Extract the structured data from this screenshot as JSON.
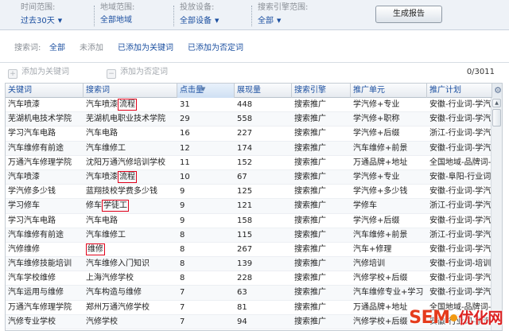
{
  "filters": [
    {
      "label": "时间范围:",
      "value": "过去30天"
    },
    {
      "label": "地域范围:",
      "value": "全部地域"
    },
    {
      "label": "投放设备:",
      "value": "全部设备"
    },
    {
      "label": "搜索引擎范围:",
      "value": "全部"
    }
  ],
  "generate_button": "生成报告",
  "search_word_filter": {
    "label": "搜索词:",
    "all": "全部",
    "not_added": "未添加",
    "added_keyword": "已添加为关键词",
    "added_negative": "已添加为否定词"
  },
  "toolbar": {
    "add_keyword": "添加为关键词",
    "add_negative": "添加为否定词",
    "page_count": "0/3011"
  },
  "table": {
    "columns": [
      "关键词",
      "搜索词",
      "点击量",
      "展现量",
      "搜索引擎",
      "推广单元",
      "推广计划"
    ],
    "sorted_column": 2,
    "rows": [
      {
        "keyword": "汽车喷漆",
        "term_pre": "汽车喷漆",
        "term_hl": "流程",
        "term_post": "",
        "clicks": "31",
        "impressions": "448",
        "engine": "搜索推广",
        "unit": "学汽修+专业",
        "plan": "安徽-行业词-学汽修"
      },
      {
        "keyword": "芜湖机电技术学院",
        "term_pre": "芜湖机电职业技术学院",
        "term_hl": "",
        "term_post": "",
        "clicks": "29",
        "impressions": "558",
        "engine": "搜索推广",
        "unit": "学汽修+职称",
        "plan": "安徽-行业词-学汽修"
      },
      {
        "keyword": "学习汽车电路",
        "term_pre": "汽车电路",
        "term_hl": "",
        "term_post": "",
        "clicks": "16",
        "impressions": "227",
        "engine": "搜索推广",
        "unit": "学汽修+后缀",
        "plan": "浙江-行业词-学汽修"
      },
      {
        "keyword": "汽车维修有前途",
        "term_pre": "汽车维修工",
        "term_hl": "",
        "term_post": "",
        "clicks": "12",
        "impressions": "174",
        "engine": "搜索推广",
        "unit": "汽车维修+前景",
        "plan": "安徽-行业词-学汽修"
      },
      {
        "keyword": "万通汽车修理学院",
        "term_pre": "沈阳万通汽修培训学校",
        "term_hl": "",
        "term_post": "",
        "clicks": "11",
        "impressions": "152",
        "engine": "搜索推广",
        "unit": "万通品牌+地址",
        "plan": "全国地域-品牌词-学"
      },
      {
        "keyword": "汽车喷漆",
        "term_pre": "汽车喷漆",
        "term_hl": "流程",
        "term_post": "",
        "clicks": "10",
        "impressions": "67",
        "engine": "搜索推广",
        "unit": "学汽修+专业",
        "plan": "安徽-阜阳-行业词-学"
      },
      {
        "keyword": "学汽修多少钱",
        "term_pre": "蓝翔技校学费多少钱",
        "term_hl": "",
        "term_post": "",
        "clicks": "9",
        "impressions": "125",
        "engine": "搜索推广",
        "unit": "学汽修+多少钱",
        "plan": "安徽-行业词-学汽修"
      },
      {
        "keyword": "学习修车",
        "term_pre": "修车",
        "term_hl": "学徒工",
        "term_post": "",
        "clicks": "9",
        "impressions": "121",
        "engine": "搜索推广",
        "unit": "学修车",
        "plan": "浙江-行业词-学汽修"
      },
      {
        "keyword": "学习汽车电路",
        "term_pre": "汽车电路",
        "term_hl": "",
        "term_post": "",
        "clicks": "9",
        "impressions": "158",
        "engine": "搜索推广",
        "unit": "学汽修+后缀",
        "plan": "安徽-行业词-学汽修"
      },
      {
        "keyword": "汽车维修有前途",
        "term_pre": "汽车维修工",
        "term_hl": "",
        "term_post": "",
        "clicks": "8",
        "impressions": "115",
        "engine": "搜索推广",
        "unit": "汽车维修+前景",
        "plan": "浙江-行业词-学汽修"
      },
      {
        "keyword": "汽修维修",
        "term_pre": "",
        "term_hl": "维修",
        "term_post": "",
        "clicks": "8",
        "impressions": "267",
        "engine": "搜索推广",
        "unit": "汽车+修理",
        "plan": "安徽-行业词-学汽修"
      },
      {
        "keyword": "汽车维修技能培训",
        "term_pre": "汽车维修入门知识",
        "term_hl": "",
        "term_post": "",
        "clicks": "8",
        "impressions": "139",
        "engine": "搜索推广",
        "unit": "汽修培训",
        "plan": "安徽-行业词-培训"
      },
      {
        "keyword": "汽车学校维修",
        "term_pre": "上海汽修学校",
        "term_hl": "",
        "term_post": "",
        "clicks": "8",
        "impressions": "228",
        "engine": "搜索推广",
        "unit": "汽修学校+后缀",
        "plan": "安徽-行业词-学汽修"
      },
      {
        "keyword": "汽车运用与维修",
        "term_pre": "汽车构造与维修",
        "term_hl": "",
        "term_post": "",
        "clicks": "7",
        "impressions": "63",
        "engine": "搜索推广",
        "unit": "汽车维修专业+学习",
        "plan": "安徽-行业词-学汽修"
      },
      {
        "keyword": "万通汽车修理学院",
        "term_pre": "郑州万通汽修学校",
        "term_hl": "",
        "term_post": "",
        "clicks": "7",
        "impressions": "81",
        "engine": "搜索推广",
        "unit": "万通品牌+地址",
        "plan": "全国地域-品牌词-学"
      },
      {
        "keyword": "汽修专业学校",
        "term_pre": "汽修学校",
        "term_hl": "",
        "term_post": "",
        "clicks": "7",
        "impressions": "94",
        "engine": "搜索推广",
        "unit": "汽修学校+后缀",
        "plan": "安徽-行业词-学汽修"
      }
    ]
  },
  "watermark": {
    "text": "SEM",
    "tail": "优化网"
  }
}
